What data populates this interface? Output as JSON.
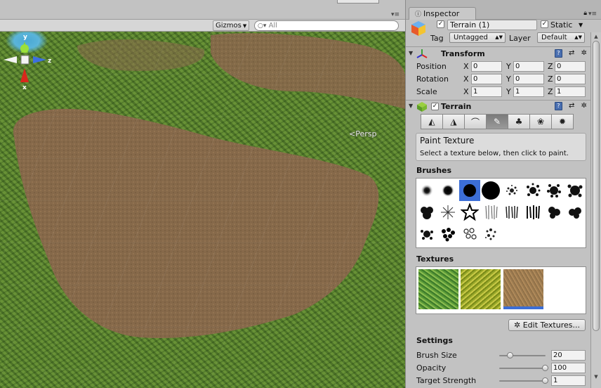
{
  "scene": {
    "toolbar": {
      "gizmos_label": "Gizmos",
      "search_placeholder": "All"
    },
    "gizmo_axes": {
      "y": "y",
      "z": "z",
      "x": "x"
    },
    "projection_label": "Persp"
  },
  "inspector": {
    "tab_label": "Inspector",
    "object": {
      "name": "Terrain (1)",
      "static_label": "Static",
      "tag_label": "Tag",
      "tag_value": "Untagged",
      "layer_label": "Layer",
      "layer_value": "Default"
    },
    "transform": {
      "title": "Transform",
      "rows": [
        {
          "label": "Position",
          "x": "0",
          "y": "0",
          "z": "0"
        },
        {
          "label": "Rotation",
          "x": "0",
          "y": "0",
          "z": "0"
        },
        {
          "label": "Scale",
          "x": "1",
          "y": "1",
          "z": "1"
        }
      ],
      "axis_labels": {
        "x": "X",
        "y": "Y",
        "z": "Z"
      }
    },
    "terrain": {
      "title": "Terrain",
      "tools": [
        "raise-lower-icon",
        "paint-height-icon",
        "smooth-height-icon",
        "paint-texture-icon",
        "place-trees-icon",
        "paint-details-icon",
        "settings-icon"
      ],
      "active_tool_index": 3,
      "help_title": "Paint Texture",
      "help_text": "Select a texture below, then click to paint.",
      "brushes_label": "Brushes",
      "selected_brush_index": 2,
      "textures_label": "Textures",
      "selected_texture_index": 2,
      "edit_textures_label": "Edit Textures...",
      "settings_label": "Settings",
      "settings": [
        {
          "label": "Brush Size",
          "value": "20",
          "fraction": 0.25
        },
        {
          "label": "Opacity",
          "value": "100",
          "fraction": 1.0
        },
        {
          "label": "Target Strength",
          "value": "1",
          "fraction": 1.0
        }
      ]
    }
  }
}
